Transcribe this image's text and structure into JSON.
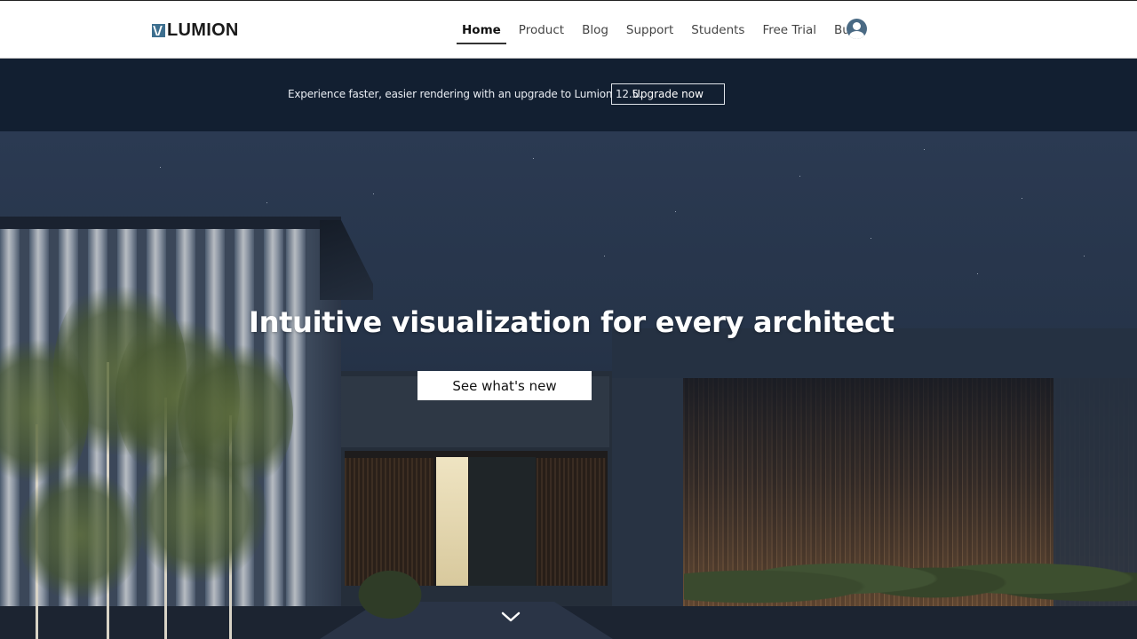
{
  "header": {
    "logo_text": "LUMION",
    "nav": [
      {
        "label": "Home",
        "active": true
      },
      {
        "label": "Product",
        "active": false
      },
      {
        "label": "Blog",
        "active": false
      },
      {
        "label": "Support",
        "active": false
      },
      {
        "label": "Students",
        "active": false
      },
      {
        "label": "Free Trial",
        "active": false
      },
      {
        "label": "Buy",
        "active": false
      }
    ],
    "account_icon": "user-circle-icon"
  },
  "banner": {
    "text": "Experience faster, easier rendering with an upgrade to Lumion 12.5.",
    "button_label": "Upgrade now"
  },
  "hero": {
    "title": "Intuitive visualization for every architect",
    "cta_label": "See what's new",
    "scroll_icon": "chevron-down-icon"
  },
  "colors": {
    "brand_blue": "#3d6f8f",
    "banner_bg": "#121f31",
    "account_icon": "#4a6a84"
  }
}
